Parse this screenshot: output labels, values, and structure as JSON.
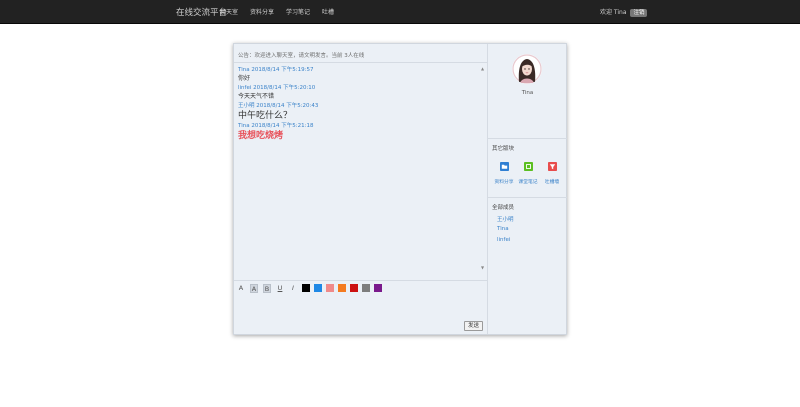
{
  "navbar": {
    "brand": "在线交流平台",
    "items": [
      "聊天室",
      "资料分享",
      "学习笔记",
      "吐槽"
    ],
    "welcome": "欢迎 Tina",
    "logout": "注销"
  },
  "chat": {
    "notice": "公告：欢迎进入聊天室，请文明发言。当前 3人在线",
    "messages": [
      {
        "head": "Tina 2018/8/14 下午5:19:57",
        "body": "你好",
        "style": "normal"
      },
      {
        "head": "linfei 2018/8/14 下午5:20:10",
        "body": "今天天气不错",
        "style": "normal"
      },
      {
        "head": "王小明 2018/8/14 下午5:20:43",
        "body": "中午吃什么？",
        "style": "big"
      },
      {
        "head": "Tina 2018/8/14 下午5:21:18",
        "body": "我想吃烧烤",
        "style": "red"
      }
    ],
    "toolbar": {
      "font_a": "A",
      "font_a_boxed": "A",
      "bold": "B",
      "underline": "U",
      "italic": "I",
      "colors": [
        "#000000",
        "#1e88e5",
        "#f08a8a",
        "#f47b20",
        "#cc1111",
        "#7d7d7d",
        "#7a1a8c"
      ]
    },
    "send_label": "发送"
  },
  "sidebar": {
    "user_name": "Tina",
    "modules_title": "其它版块",
    "modules": [
      {
        "label": "资料分享",
        "icon": "folder-icon",
        "color": "#2f7fd3"
      },
      {
        "label": "课堂笔记",
        "icon": "note-icon",
        "color": "#5bbf21"
      },
      {
        "label": "吐槽墙",
        "icon": "filter-icon",
        "color": "#e84c4c"
      }
    ],
    "members_title": "全部成员",
    "members": [
      "王小明",
      "Tina",
      "linfei"
    ]
  }
}
